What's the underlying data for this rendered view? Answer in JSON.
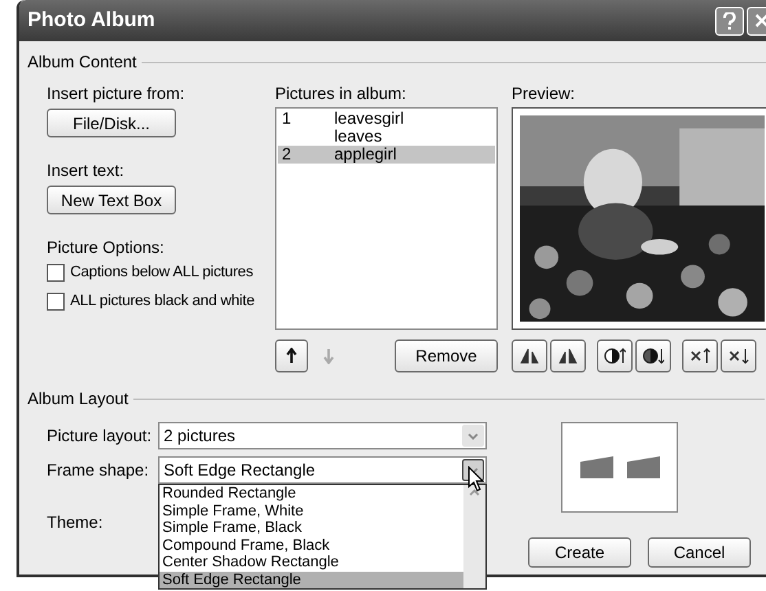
{
  "window": {
    "title": "Photo Album"
  },
  "album_content": {
    "label": "Album Content",
    "insert_picture": {
      "label": "Insert picture from:",
      "button": "File/Disk..."
    },
    "insert_text": {
      "label": "Insert text:",
      "button": "New Text Box"
    },
    "picture_options": {
      "label": "Picture Options:",
      "options": [
        {
          "label": "Captions below ALL pictures",
          "checked": false
        },
        {
          "label": "ALL pictures black and white",
          "checked": false
        }
      ]
    },
    "pictures": {
      "label": "Pictures in album:",
      "items": [
        {
          "number": "1",
          "name": "leavesgirl",
          "selected": false
        },
        {
          "name": "leaves",
          "selected": false
        },
        {
          "number": "2",
          "name": "applegirl",
          "selected": true
        }
      ]
    },
    "order_buttons": [
      {
        "kind": "up",
        "disabled": false
      },
      {
        "kind": "down",
        "disabled": true
      }
    ],
    "remove_button": "Remove",
    "preview": {
      "label": "Preview:"
    }
  },
  "album_layout": {
    "label": "Album Layout",
    "fields": [
      {
        "label": "Picture layout:",
        "value": "2 pictures",
        "expanded": false
      },
      {
        "label": "Frame shape:",
        "value": "Soft Edge Rectangle",
        "expanded": true
      }
    ],
    "theme": {
      "label": "Theme:"
    },
    "frame_options": [
      {
        "label": "Rounded Rectangle",
        "selected": false
      },
      {
        "label": "Simple Frame, White",
        "selected": false
      },
      {
        "label": "Simple Frame, Black",
        "selected": false
      },
      {
        "label": "Compound Frame, Black",
        "selected": false
      },
      {
        "label": "Center Shadow Rectangle",
        "selected": false
      },
      {
        "label": "Soft Edge Rectangle",
        "selected": true
      }
    ],
    "buttons": [
      "Create",
      "Cancel"
    ]
  }
}
